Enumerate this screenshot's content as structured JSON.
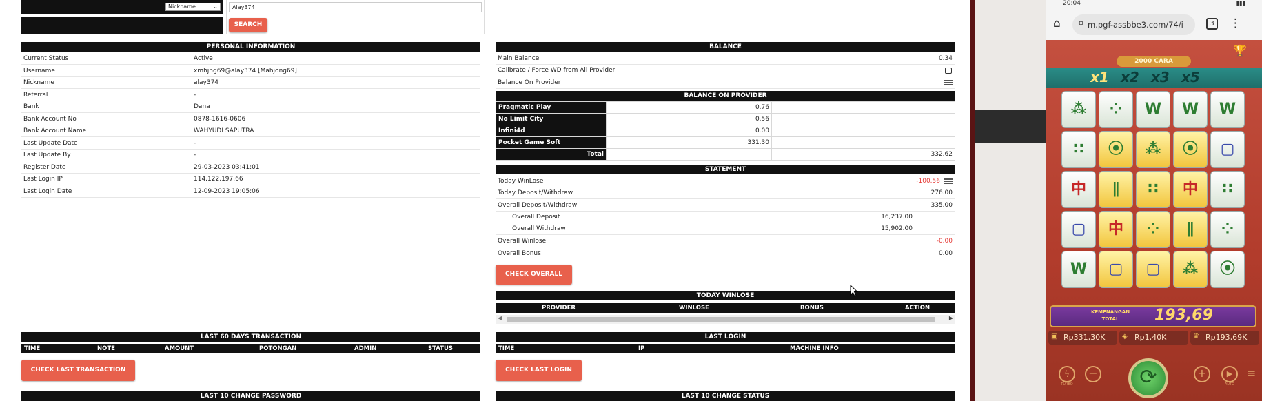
{
  "search": {
    "filter_value": "Nickname",
    "query_value": "Alay374",
    "search_label": "SEARCH"
  },
  "personal": {
    "title": "PERSONAL INFORMATION",
    "rows": [
      {
        "label": "Current Status",
        "value": "Active"
      },
      {
        "label": "Username",
        "value": "xmhjng69@alay374  [Mahjong69]"
      },
      {
        "label": "Nickname",
        "value": "alay374"
      },
      {
        "label": "Referral",
        "value": "-"
      },
      {
        "label": "Bank",
        "value": "Dana"
      },
      {
        "label": "Bank Account No",
        "value": "0878-1616-0606"
      },
      {
        "label": "Bank Account Name",
        "value": "WAHYUDI SAPUTRA"
      },
      {
        "label": "Last Update Date",
        "value": "-"
      },
      {
        "label": "Last Update By",
        "value": "-"
      },
      {
        "label": "Register Date",
        "value": "29-03-2023 03:41:01"
      },
      {
        "label": "Last Login IP",
        "value": "114.122.197.66"
      },
      {
        "label": "Last Login Date",
        "value": "12-09-2023 19:05:06"
      }
    ]
  },
  "balance": {
    "title": "BALANCE",
    "main_label": "Main Balance",
    "main_value": "0.34",
    "calibrate_label": "Calibrate / Force WD from All Provider",
    "on_provider_label": "Balance On Provider",
    "on_provider_title": "BALANCE ON PROVIDER",
    "providers": [
      {
        "name": "Pragmatic Play",
        "value": "0.76"
      },
      {
        "name": "No Limit City",
        "value": "0.56"
      },
      {
        "name": "Infini4d",
        "value": "0.00"
      },
      {
        "name": "Pocket Game Soft",
        "value": "331.30"
      }
    ],
    "total_label": "Total",
    "total_value": "332.62"
  },
  "statement": {
    "title": "STATEMENT",
    "today_winlose_label": "Today WinLose",
    "today_winlose_value": "-100.56",
    "today_dw_label": "Today Deposit/Withdraw",
    "today_dw_value": "276.00",
    "overall_dw_label": "Overall Deposit/Withdraw",
    "overall_dw_value": "335.00",
    "overall_deposit_label": "Overall Deposit",
    "overall_deposit_value": "16,237.00",
    "overall_withdraw_label": "Overall Withdraw",
    "overall_withdraw_value": "15,902.00",
    "overall_winlose_label": "Overall Winlose",
    "overall_winlose_value": "-0.00",
    "overall_bonus_label": "Overall Bonus",
    "overall_bonus_value": "0.00",
    "check_overall_label": "CHECK OVERALL"
  },
  "today_winlose": {
    "title": "TODAY WINLOSE",
    "cols": [
      "PROVIDER",
      "WINLOSE",
      "BONUS",
      "ACTION"
    ]
  },
  "last60": {
    "title": "LAST 60 DAYS TRANSACTION",
    "cols": [
      "TIME",
      "NOTE",
      "AMOUNT",
      "POTONGAN",
      "ADMIN",
      "STATUS"
    ],
    "button": "CHECK LAST TRANSACTION"
  },
  "last_login": {
    "title": "LAST LOGIN",
    "cols": [
      "TIME",
      "IP",
      "MACHINE INFO"
    ],
    "button": "CHECK LAST LOGIN"
  },
  "pw_title": "LAST 10 CHANGE PASSWORD",
  "status_title": "LAST 10 CHANGE STATUS",
  "phone": {
    "time": "20:04",
    "url": "m.pgf-assbbe3.com/74/i",
    "tabs_count": "3",
    "banner": "2000 CARA",
    "multipliers": [
      "x1",
      "x2",
      "x3",
      "x5"
    ],
    "win_label": "KEMENANGAN\nTOTAL",
    "win_value": "193,69",
    "balance": "Rp331,30K",
    "bet": "Rp1,40K",
    "win": "Rp193,69K",
    "turbo": "TURBO",
    "auto": "AUTO"
  },
  "colors": {
    "accent": "#e8604c",
    "header": "#111111",
    "negative": "#e53935"
  }
}
